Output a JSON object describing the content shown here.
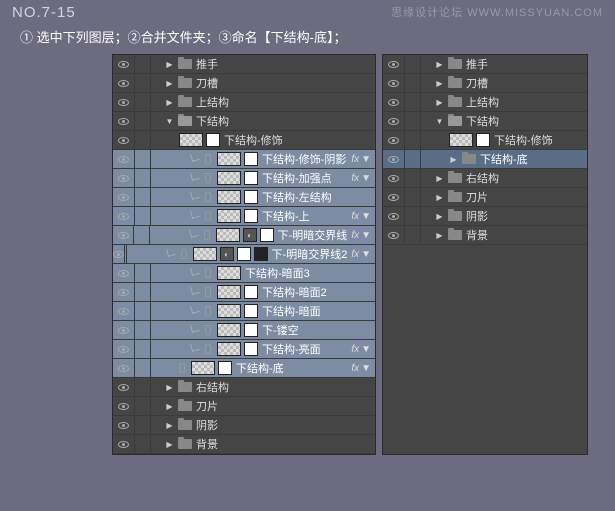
{
  "header": {
    "title": "NO.7-15",
    "watermark": "思缘设计论坛 WWW.MISSYUAN.COM"
  },
  "instruction": "① 选中下列图层；②合并文件夹；③命名【下结构-底】；",
  "left": [
    {
      "t": "folder",
      "label": "推手",
      "tw": "▶",
      "ind": 8
    },
    {
      "t": "folder",
      "label": "刀槽",
      "tw": "▶",
      "ind": 8
    },
    {
      "t": "folder",
      "label": "上结构",
      "tw": "▶",
      "ind": 8
    },
    {
      "t": "folder",
      "label": "下结构",
      "tw": "▼",
      "ind": 8,
      "open": true
    },
    {
      "t": "layer",
      "label": "下结构-修饰",
      "ind": 22,
      "mask": true
    },
    {
      "t": "layer",
      "label": "下结构-修饰-阴影",
      "ind": 34,
      "sel": true,
      "fx": true,
      "clip": true,
      "mask": true
    },
    {
      "t": "layer",
      "label": "下结构-加强点",
      "ind": 34,
      "sel": true,
      "fx": true,
      "clip": true,
      "mask": true
    },
    {
      "t": "layer",
      "label": "下结构-左结构",
      "ind": 34,
      "sel": true,
      "clip": true,
      "mask": true
    },
    {
      "t": "layer",
      "label": "下结构-上",
      "ind": 34,
      "sel": true,
      "fx": true,
      "clip": true,
      "mask": true
    },
    {
      "t": "layer",
      "label": "下-明暗交界线",
      "ind": 34,
      "sel": true,
      "fx": true,
      "clip": true,
      "mask": true,
      "so": true
    },
    {
      "t": "layer",
      "label": "下-明暗交界线2",
      "ind": 34,
      "sel": true,
      "fx": true,
      "clip": true,
      "mask": true,
      "mask2": true,
      "so": true
    },
    {
      "t": "layer",
      "label": "下结构-暗面3",
      "ind": 34,
      "sel": true,
      "clip": true
    },
    {
      "t": "layer",
      "label": "下结构-暗面2",
      "ind": 34,
      "sel": true,
      "clip": true,
      "mask": true
    },
    {
      "t": "layer",
      "label": "下结构-暗面",
      "ind": 34,
      "sel": true,
      "clip": true,
      "mask": true
    },
    {
      "t": "layer",
      "label": "下-镂空",
      "ind": 34,
      "sel": true,
      "clip": true,
      "mask": true
    },
    {
      "t": "layer",
      "label": "下结构-亮面",
      "ind": 34,
      "sel": true,
      "fx": true,
      "clip": true,
      "mask": true
    },
    {
      "t": "layer",
      "label": "下结构-底",
      "ind": 22,
      "sel": true,
      "fx": true,
      "mask": true
    },
    {
      "t": "folder",
      "label": "右结构",
      "tw": "▶",
      "ind": 8
    },
    {
      "t": "folder",
      "label": "刀片",
      "tw": "▶",
      "ind": 8
    },
    {
      "t": "folder",
      "label": "阴影",
      "tw": "▶",
      "ind": 8
    },
    {
      "t": "folder",
      "label": "背景",
      "tw": "▶",
      "ind": 8
    }
  ],
  "right": [
    {
      "t": "folder",
      "label": "推手",
      "tw": "▶",
      "ind": 8
    },
    {
      "t": "folder",
      "label": "刀槽",
      "tw": "▶",
      "ind": 8
    },
    {
      "t": "folder",
      "label": "上结构",
      "tw": "▶",
      "ind": 8
    },
    {
      "t": "folder",
      "label": "下结构",
      "tw": "▼",
      "ind": 8,
      "open": true
    },
    {
      "t": "layer",
      "label": "下结构-修饰",
      "ind": 22,
      "mask": true
    },
    {
      "t": "folder",
      "label": "下结构-底",
      "tw": "▶",
      "ind": 22,
      "fsel": true
    },
    {
      "t": "folder",
      "label": "右结构",
      "tw": "▶",
      "ind": 8
    },
    {
      "t": "folder",
      "label": "刀片",
      "tw": "▶",
      "ind": 8
    },
    {
      "t": "folder",
      "label": "阴影",
      "tw": "▶",
      "ind": 8
    },
    {
      "t": "folder",
      "label": "背景",
      "tw": "▶",
      "ind": 8
    }
  ],
  "fx_label": "fx",
  "fx_tw": "▼"
}
